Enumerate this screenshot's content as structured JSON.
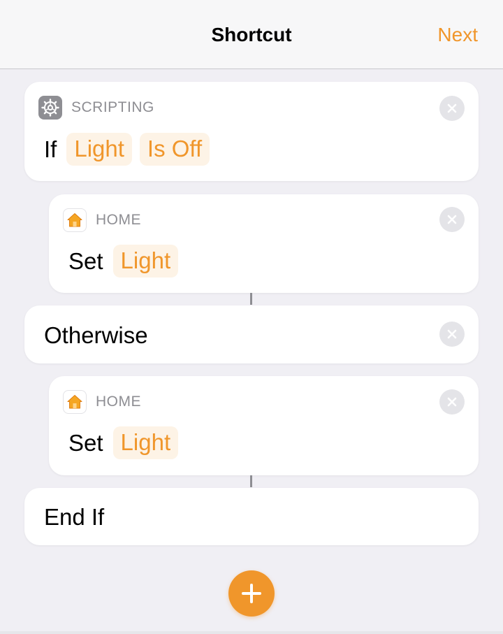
{
  "navbar": {
    "title": "Shortcut",
    "next_label": "Next"
  },
  "actions": [
    {
      "category": "SCRIPTING",
      "icon": "gear-icon",
      "keyword": "If",
      "tokens": [
        "Light",
        "Is Off"
      ]
    },
    {
      "category": "HOME",
      "icon": "home-icon",
      "keyword": "Set",
      "tokens": [
        "Light"
      ]
    },
    {
      "label": "Otherwise"
    },
    {
      "category": "HOME",
      "icon": "home-icon",
      "keyword": "Set",
      "tokens": [
        "Light"
      ]
    },
    {
      "label": "End If"
    }
  ],
  "colors": {
    "accent": "#f0962b",
    "token_bg": "#fdf3e6",
    "background": "#f0eff4",
    "card": "#ffffff",
    "secondary_text": "#8e8e93"
  },
  "add_button": {
    "icon": "plus-icon"
  }
}
